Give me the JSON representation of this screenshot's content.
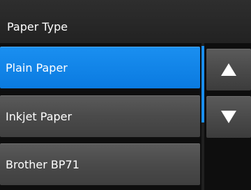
{
  "header": {
    "title": "Paper Type"
  },
  "list": {
    "items": [
      {
        "label": "Plain Paper",
        "selected": true
      },
      {
        "label": "Inkjet Paper",
        "selected": false
      },
      {
        "label": "Brother BP71",
        "selected": false
      }
    ]
  },
  "navigation": {
    "up_icon": "triangle-up-icon",
    "down_icon": "triangle-down-icon"
  },
  "colors": {
    "selected_accent": "#1a8ff0",
    "item_background": "#4a4a4a",
    "header_background": "#282828"
  }
}
